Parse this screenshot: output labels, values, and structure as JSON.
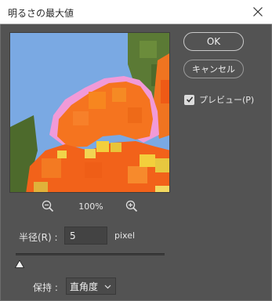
{
  "window": {
    "title": "明るさの最大値",
    "close_icon": "close-icon"
  },
  "buttons": {
    "ok_label": "OK",
    "cancel_label": "キャンセル"
  },
  "preview_checkbox": {
    "label": "プレビュー(P)",
    "checked": true
  },
  "zoom": {
    "level": "100%",
    "zoom_out_icon": "zoom-out-icon",
    "zoom_in_icon": "zoom-in-icon"
  },
  "radius": {
    "label": "半径(R) :",
    "value": "5",
    "unit": "pixel",
    "slider_fraction": 0.01
  },
  "preserve": {
    "label": "保持 :",
    "selected": "直角度"
  },
  "colors": {
    "background": "#535353",
    "sky": "#7aa9e3",
    "petal_orange": "#f5741f",
    "petal_pink": "#f19ad8",
    "foliage": "#5b7a35",
    "center_yellow": "#f3cf3c"
  }
}
